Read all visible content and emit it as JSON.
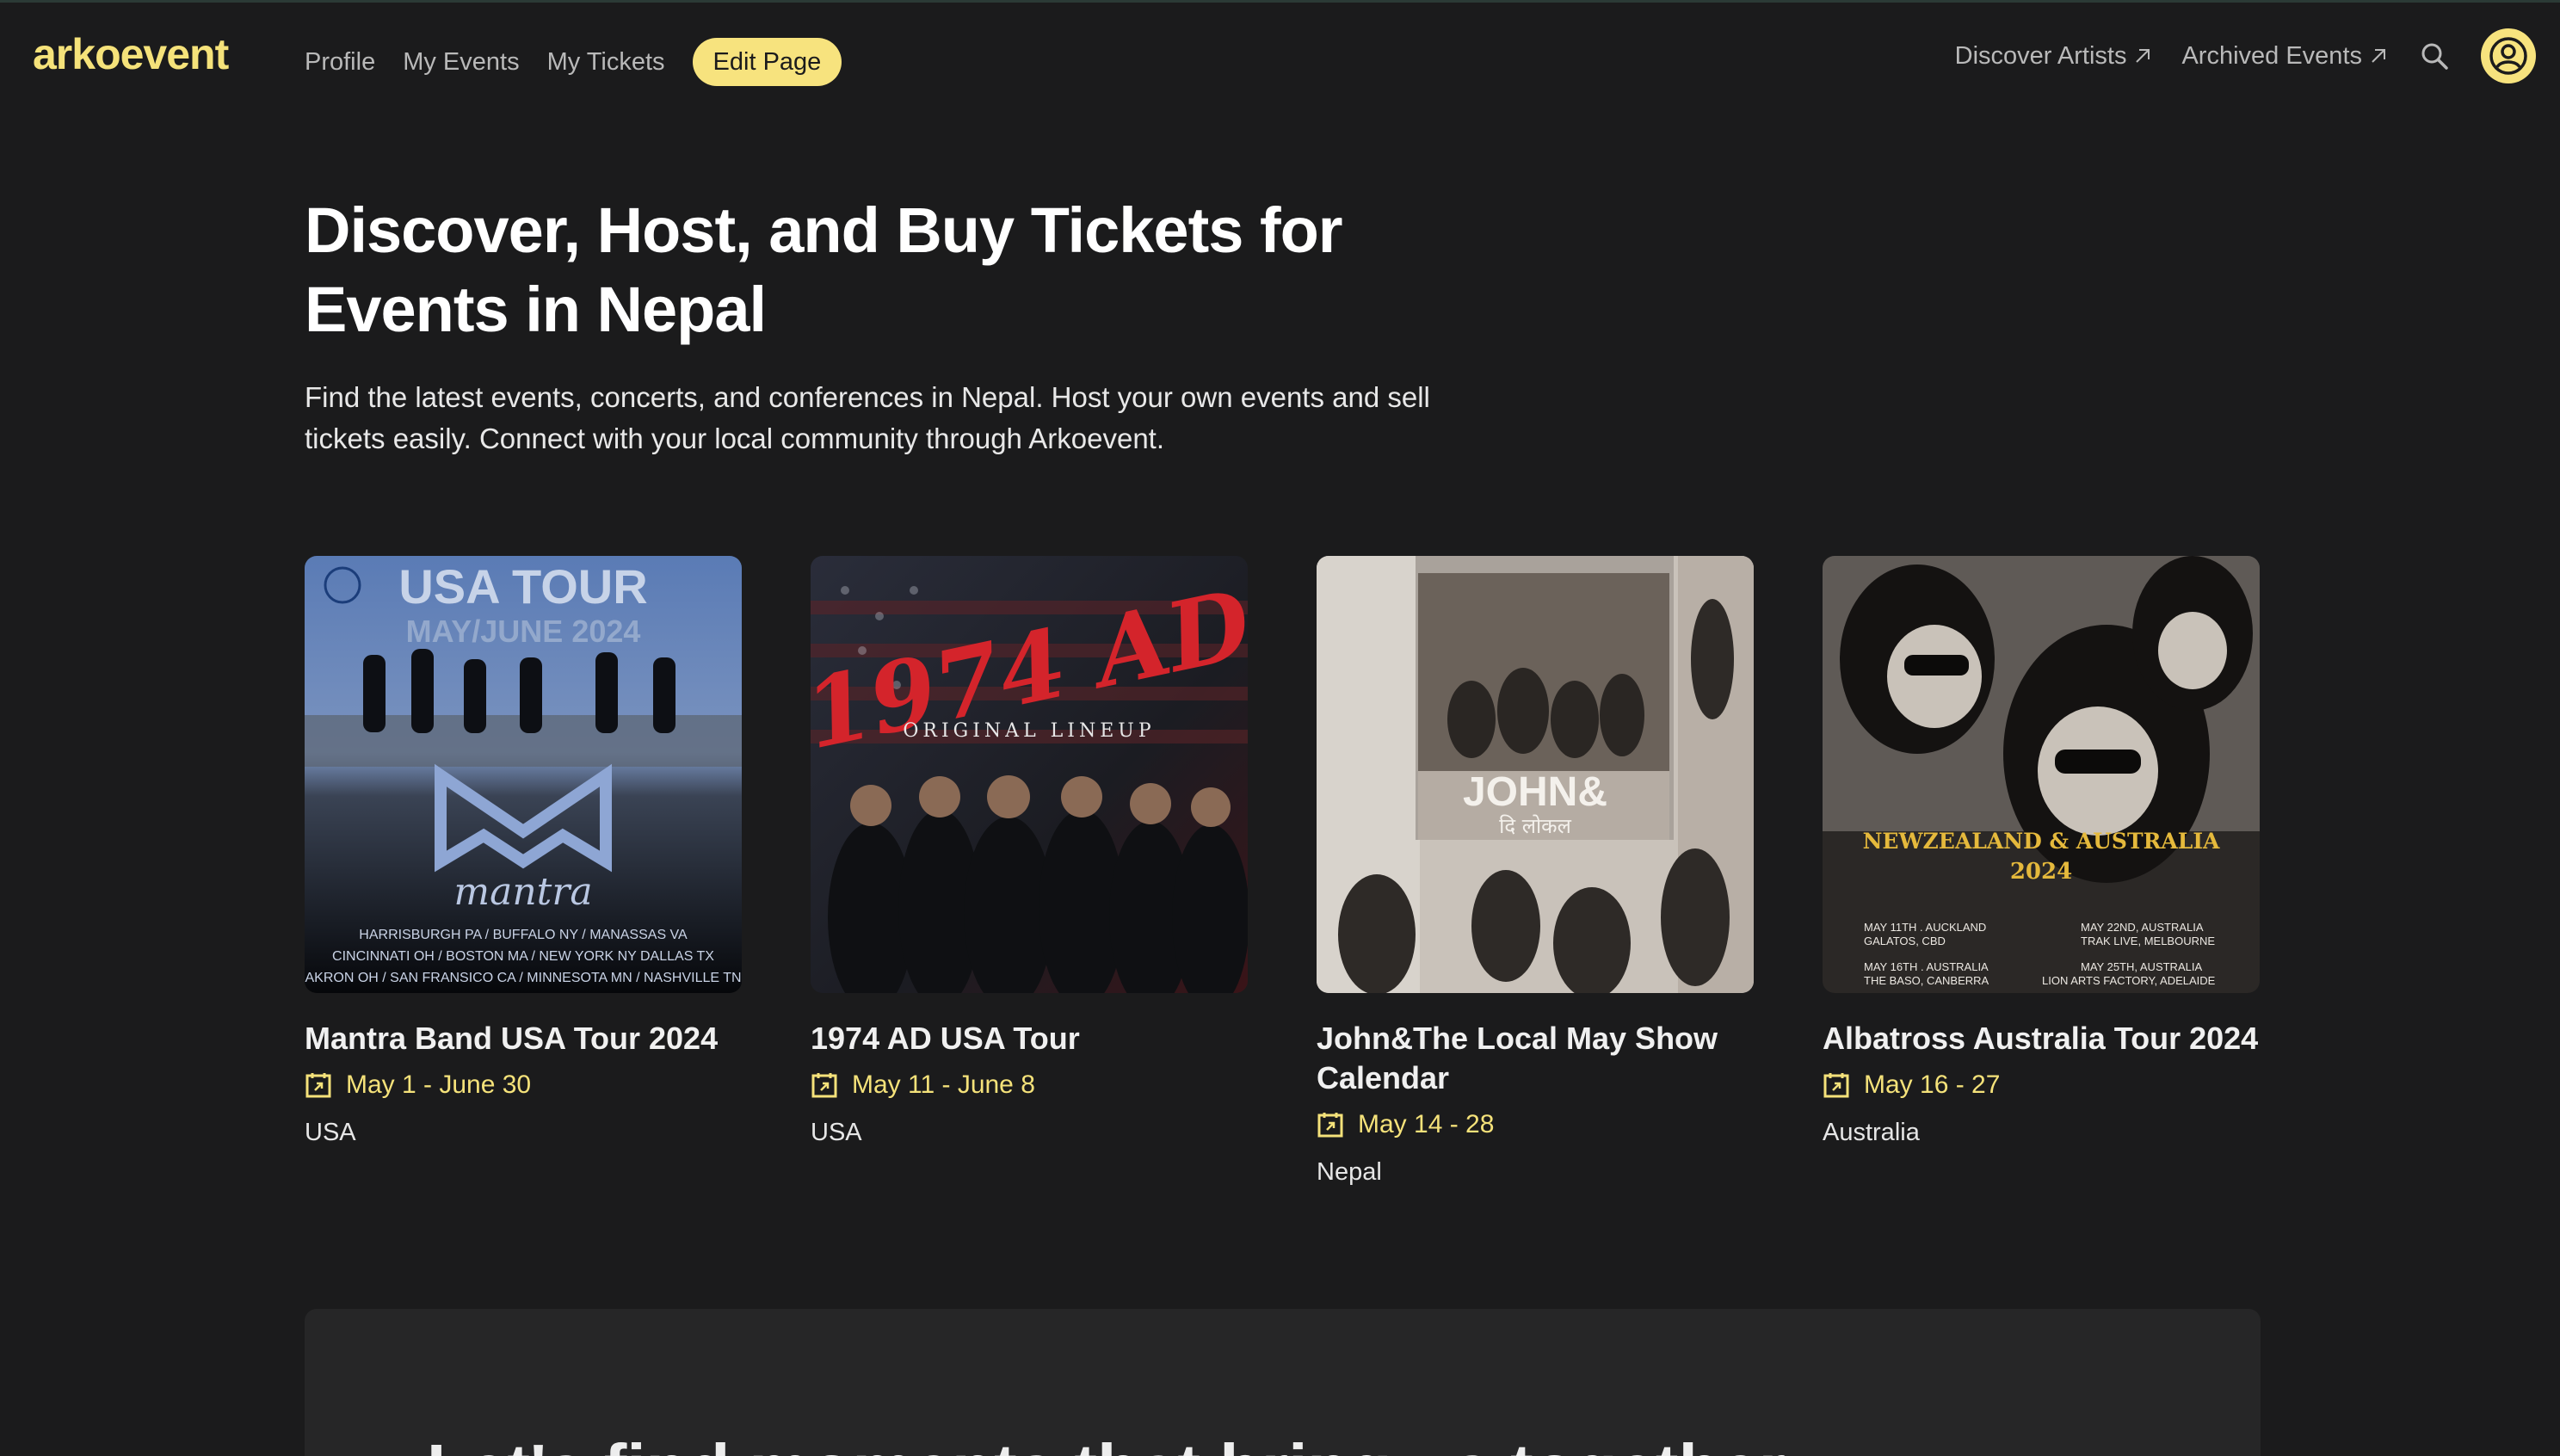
{
  "nav": {
    "logo": "arkoevent",
    "links": [
      "Profile",
      "My Events",
      "My Tickets"
    ],
    "edit_button": "Edit Page",
    "external_links": [
      "Discover Artists",
      "Archived Events"
    ]
  },
  "hero": {
    "title": "Discover, Host, and Buy Tickets for Events in Nepal",
    "subtitle": "Find the latest events, concerts, and conferences in Nepal. Host your own events and sell tickets easily. Connect with your local community through Arkoevent."
  },
  "events": [
    {
      "title": "Mantra Band USA Tour 2024",
      "date": "May 1 - June 30",
      "location": "USA",
      "poster": {
        "heading": "USA TOUR",
        "subheading": "MAY/JUNE 2024",
        "name": "mantra",
        "cities": [
          "HARRISBURGH PA / BUFFALO NY / MANASSAS VA",
          "CINCINNATI OH / BOSTON MA / NEW YORK NY DALLAS TX",
          "AKRON OH / SAN FRANSICO CA / MINNESOTA MN / NASHVILLE TN"
        ]
      }
    },
    {
      "title": "1974 AD USA Tour",
      "date": "May 11 - June 8",
      "location": "USA",
      "poster": {
        "heading": "1974 AD",
        "subheading": "ORIGINAL LINEUP"
      }
    },
    {
      "title": "John&The Local May Show Calendar",
      "date": "May 14 - 28",
      "location": "Nepal",
      "poster": {
        "heading": "JOHN&",
        "subheading": "दि लोकल"
      }
    },
    {
      "title": "Albatross Australia Tour 2024",
      "date": "May 16 - 27",
      "location": "Australia",
      "poster": {
        "heading": "NEWZEALAND & AUSTRALIA",
        "subheading": "2024",
        "dates": [
          "MAY 11TH . AUCKLAND",
          "GALATOS, CBD",
          "MAY 22ND, AUSTRALIA",
          "TRAK LIVE, MELBOURNE",
          "MAY 16TH . AUSTRALIA",
          "THE BASO, CANBERRA",
          "MAY 25TH, AUSTRALIA",
          "LION ARTS FACTORY, ADELAIDE"
        ]
      }
    }
  ],
  "panel": {
    "text": "Let's find moments that bring us together"
  },
  "colors": {
    "background": "#1b1b1c",
    "accent": "#f7e37e",
    "panel": "#262627"
  }
}
